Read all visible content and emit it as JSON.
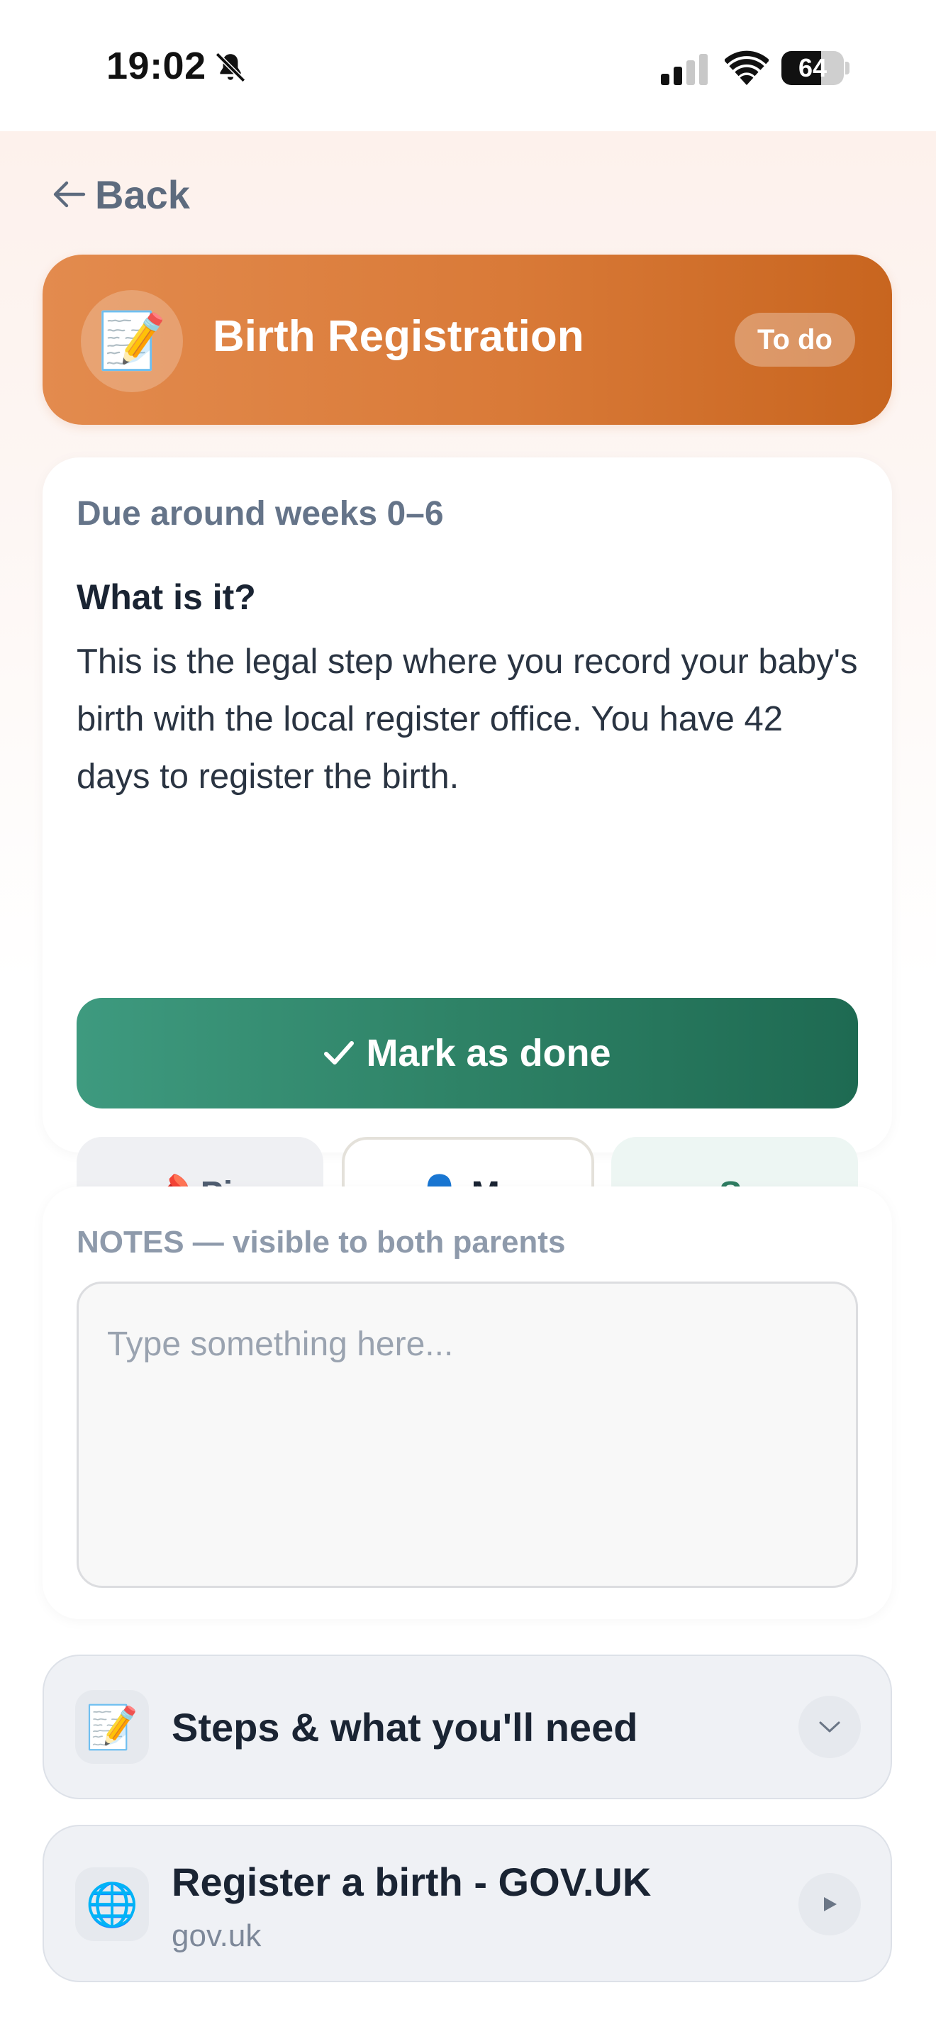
{
  "status_bar": {
    "time": "19:02",
    "battery": "64",
    "battery_level": 0.64
  },
  "nav": {
    "back_label": "Back"
  },
  "header": {
    "emoji": "📝",
    "title": "Birth Registration",
    "badge": "To do"
  },
  "info": {
    "due": "Due around weeks 0–6",
    "what_title": "What is it?",
    "description": "This is the legal step where you record your baby's birth with the local register office. You have 42 days to register the birth.",
    "mark_done_label": "Mark as done",
    "pin": {
      "emoji": "📌",
      "label": "Pin"
    },
    "me": {
      "emoji": "👤",
      "label": "Me"
    },
    "assign": {
      "arrow": "→",
      "label": "Sam"
    }
  },
  "notes": {
    "label": "NOTES — visible to both parents",
    "placeholder": "Type something here..."
  },
  "steps": {
    "emoji": "📝",
    "title": "Steps & what you'll need"
  },
  "link": {
    "emoji": "🌐",
    "title": "Register a birth - GOV.UK",
    "subtitle": "gov.uk"
  },
  "colors": {
    "accent_orange": "#d97a38",
    "accent_green": "#2e8266",
    "text_muted": "#657489"
  }
}
